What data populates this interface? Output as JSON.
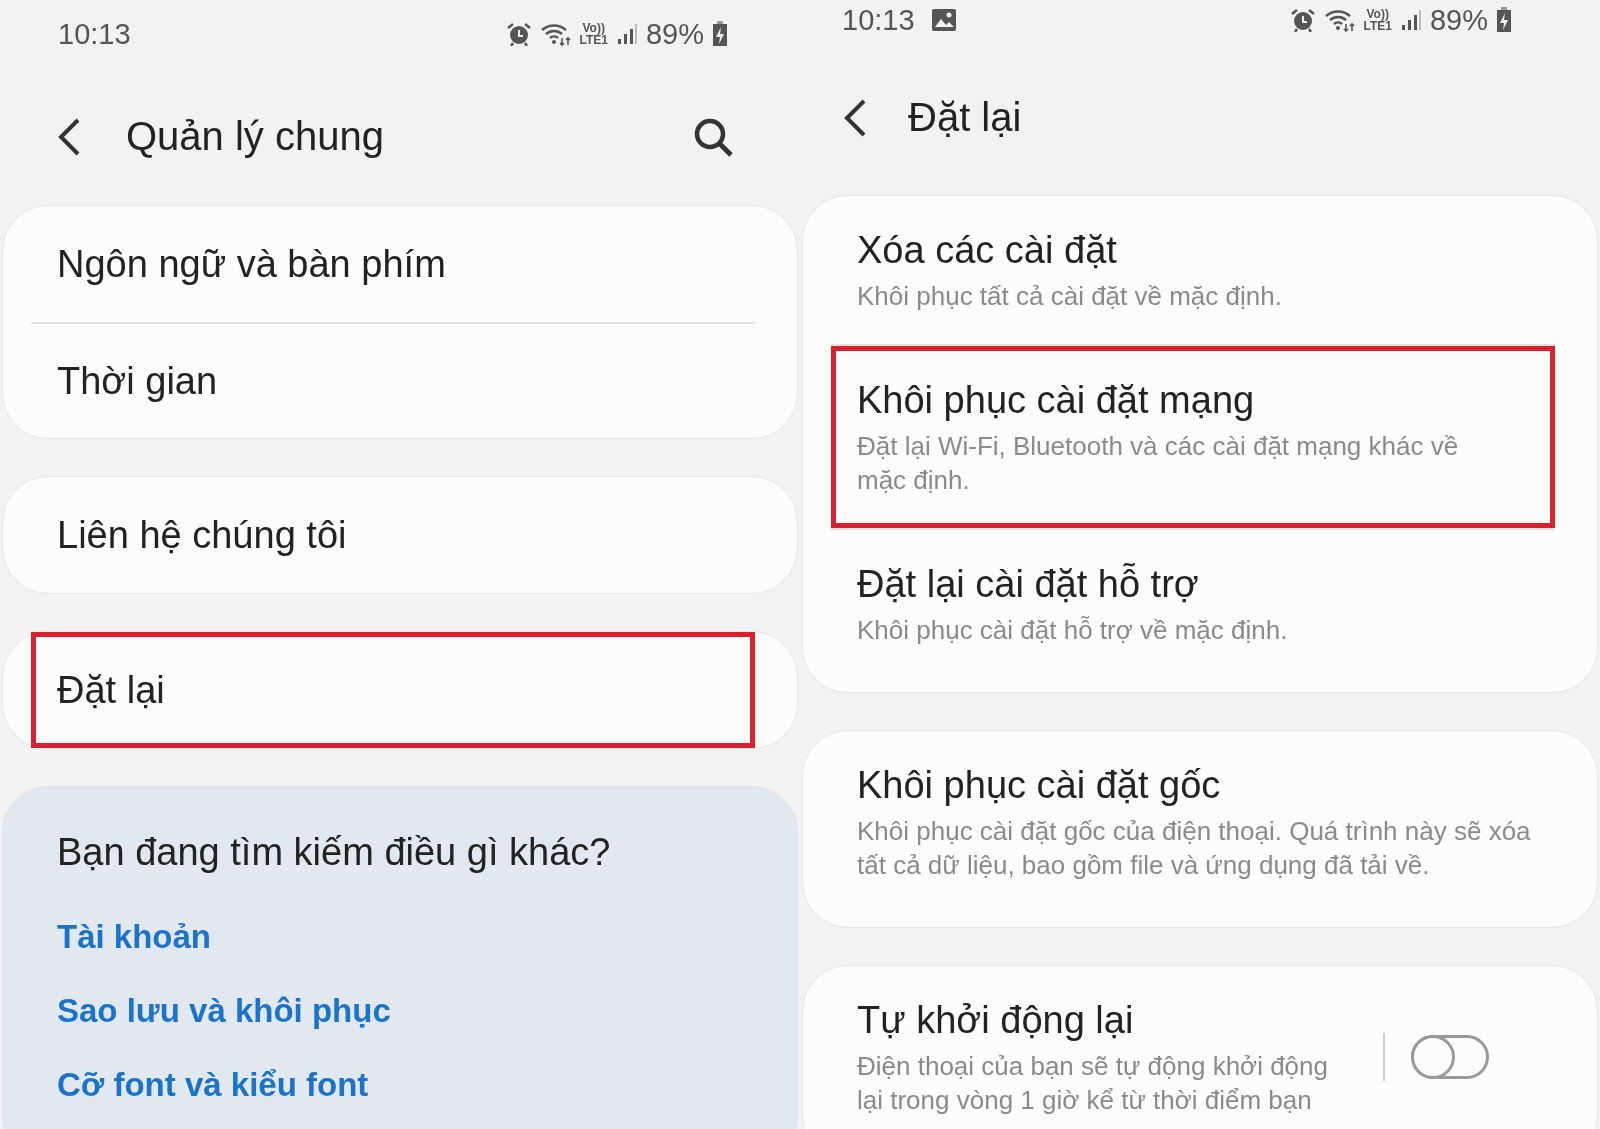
{
  "panes": [
    {
      "status_bar": {
        "time": "10:13",
        "volte": "Vo))",
        "lte": "LTE1",
        "battery": "89%"
      },
      "header": {
        "title": "Quản lý chung",
        "actions": [
          {
            "kind": "search"
          }
        ]
      },
      "cards": [
        {
          "kind": "list",
          "items": [
            {
              "title": "Ngôn ngữ và bàn phím",
              "highlighted": false
            },
            {
              "title": "Thời gian",
              "highlighted": false
            }
          ]
        },
        {
          "kind": "list",
          "items": [
            {
              "title": "Liên hệ chúng tôi",
              "highlighted": false
            }
          ]
        },
        {
          "kind": "list",
          "items": [
            {
              "title": "Đặt lại",
              "highlighted": true
            }
          ]
        },
        {
          "kind": "suggestions",
          "heading": "Bạn đang tìm kiếm điều gì khác?",
          "links": [
            "Tài khoản",
            "Sao lưu và khôi phục",
            "Cỡ font và kiểu font"
          ]
        }
      ]
    },
    {
      "status_bar": {
        "time": "10:13",
        "notifications": [
          {
            "kind": "image"
          }
        ],
        "volte": "Vo))",
        "lte": "LTE1",
        "battery": "89%"
      },
      "header": {
        "title": "Đặt lại"
      },
      "cards": [
        {
          "kind": "list",
          "items": [
            {
              "title": "Xóa các cài đặt",
              "subtitle": "Khôi phục tất cả cài đặt về mặc định.",
              "highlighted": false
            },
            {
              "title": "Khôi phục cài đặt mạng",
              "subtitle": "Đặt lại Wi-Fi, Bluetooth và các cài đặt mạng khác về mặc định.",
              "highlighted": true
            },
            {
              "title": "Đặt lại cài đặt hỗ trợ",
              "subtitle": "Khôi phục cài đặt hỗ trợ về mặc định.",
              "highlighted": false
            }
          ]
        },
        {
          "kind": "list",
          "items": [
            {
              "title": "Khôi phục cài đặt gốc",
              "subtitle": "Khôi phục cài đặt gốc của điện thoại. Quá trình này sẽ xóa tất cả dữ liệu, bao gồm file và ứng dụng đã tải về.",
              "highlighted": false
            }
          ]
        },
        {
          "kind": "list",
          "items": [
            {
              "title": "Tự khởi động lại",
              "subtitle": "Điện thoại của bạn sẽ tự động khởi động lại trong vòng 1 giờ kể từ thời điểm bạn",
              "highlighted": false,
              "toggle": {
                "on": false
              }
            }
          ]
        }
      ]
    }
  ]
}
